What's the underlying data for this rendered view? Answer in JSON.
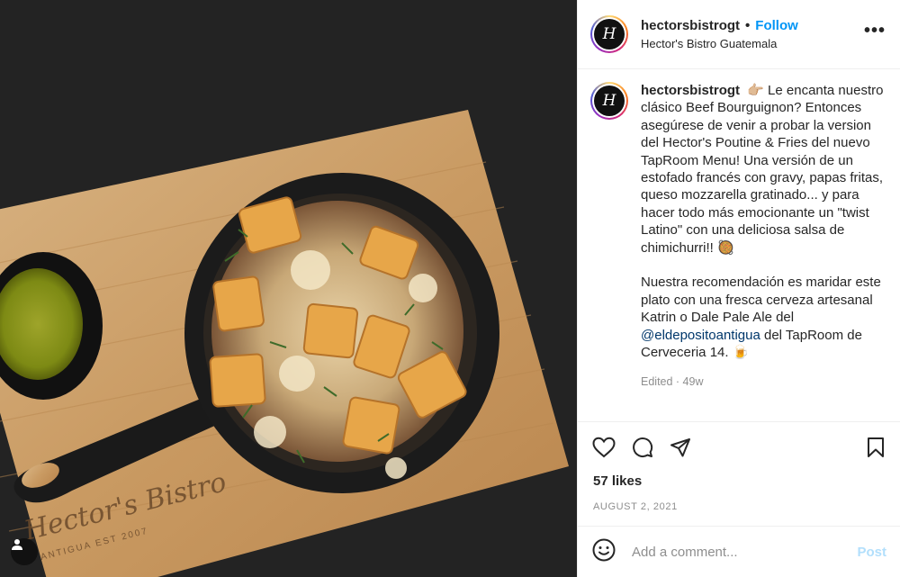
{
  "post": {
    "image_alt": "Hector's Poutine & Fries served in a cast iron skillet on a wooden board",
    "board_engraving": {
      "brand": "Hector's Bistro",
      "tagline": "ANTIGUA EST 2007"
    }
  },
  "header": {
    "username": "hectorsbistrogt",
    "separator": "•",
    "follow_label": "Follow",
    "location": "Hector's Bistro Guatemala",
    "more_label": "•••"
  },
  "caption": {
    "username": "hectorsbistrogt",
    "paragraph1": "👉🏼 Le encanta nuestro clásico Beef Bourguignon? Entonces asegúrese de venir a probar la version del Hector's Poutine & Fries del nuevo TapRoom Menu! Una versión de un estofado francés con gravy, papas fritas, queso mozzarella gratinado... y para hacer todo más emocionante un \"twist Latino\" con una deliciosa salsa de chimichurri!! 🥘",
    "paragraph2_before": "Nuestra recomendación es maridar este plato con una fresca cerveza artesanal Katrin o Dale Pale Ale del ",
    "mention": "@eldepositoantigua",
    "paragraph2_after": " del TapRoom de Cerveceria 14. 🍺",
    "edited": "Edited · 49w"
  },
  "engagement": {
    "likes": "57 likes",
    "date": "AUGUST 2, 2021"
  },
  "comment": {
    "placeholder": "Add a comment...",
    "post_label": "Post"
  },
  "icons": {
    "avatar_monogram": "H",
    "like": "heart-icon",
    "comment": "comment-bubble-icon",
    "share": "paper-plane-icon",
    "save": "bookmark-icon",
    "emoji": "smiley-icon",
    "tag": "user-tag-icon"
  },
  "colors": {
    "link_blue": "#0095f6",
    "mention": "#00376b",
    "muted": "#8e8e8e",
    "post_disabled": "#b2dffc"
  }
}
